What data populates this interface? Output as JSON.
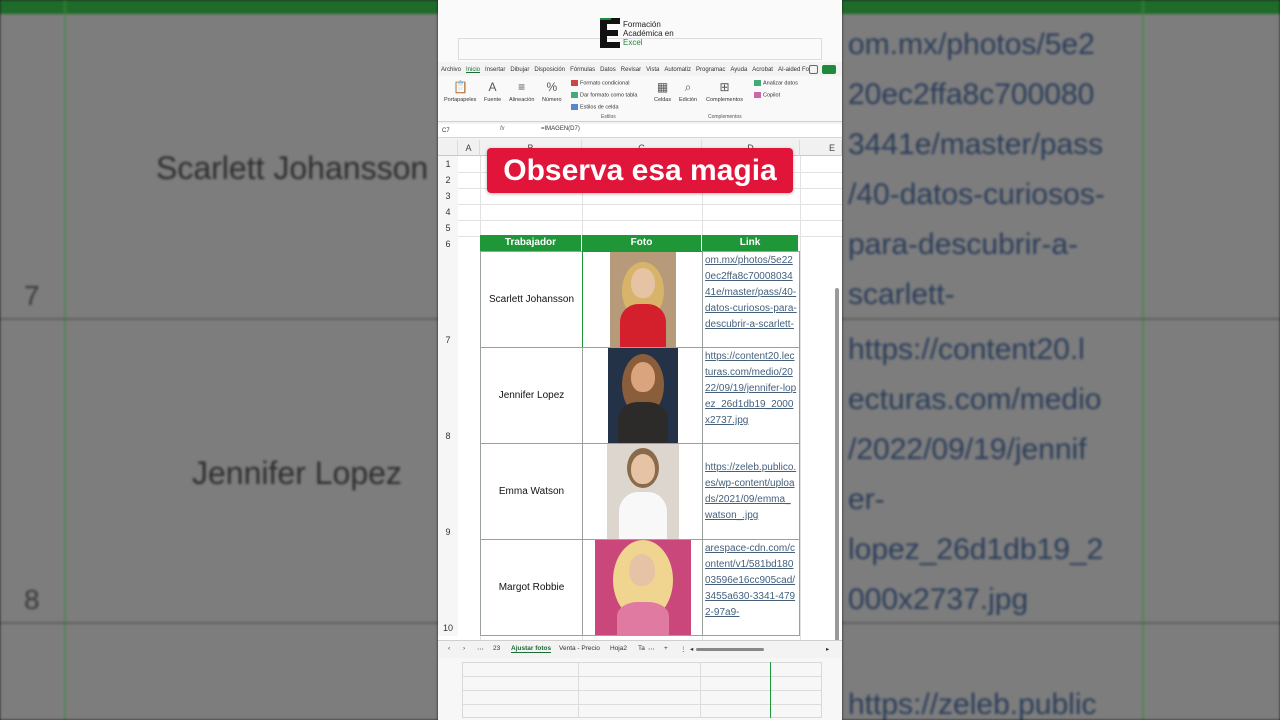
{
  "brand": {
    "line1": "Formación",
    "line2": "Académica en",
    "line3": "Excel"
  },
  "ribbon_tabs": [
    "Archivo",
    "Inicio",
    "Insertar",
    "Dibujar",
    "Disposición",
    "Fórmulas",
    "Datos",
    "Revisar",
    "Vista",
    "Automatiz",
    "Programac",
    "Ayuda",
    "Acrobat",
    "AI-aided Fo"
  ],
  "active_tab": "Inicio",
  "ribbon": {
    "portapapeles": "Portapapeles",
    "fuente": "Fuente",
    "alineacion": "Alineación",
    "numero": "Número",
    "formato_condicional": "Formato condicional",
    "dar_formato": "Dar formato como tabla",
    "estilos_celda": "Estilos de celda",
    "estilos_label": "Estilos",
    "celdas": "Celdas",
    "edicion": "Edición",
    "complementos": "Complementos",
    "complementos_label": "Complementos",
    "analizar": "Analizar datos",
    "copilot": "Copilot"
  },
  "formula_bar": {
    "namebox": "C7",
    "fx": "fx",
    "formula": "=IMAGEN(D7)"
  },
  "columns": [
    "A",
    "B",
    "C",
    "D",
    "E"
  ],
  "rows": [
    "1",
    "2",
    "3",
    "4",
    "5",
    "6",
    "7",
    "8",
    "9",
    "10"
  ],
  "overlay_title": "Observa esa magia",
  "table": {
    "headers": [
      "Trabajador",
      "Foto",
      "Link"
    ],
    "rows": [
      {
        "name": "Scarlett Johansson",
        "link": "om.mx/photos/5e220ec2ffa8c7000803441e/master/pass/40-datos-curiosos-para-descubrir-a-scarlett-"
      },
      {
        "name": "Jennifer Lopez",
        "link": "https://content20.lecturas.com/medio/2022/09/19/jennifer-lopez_26d1db19_2000x2737.jpg"
      },
      {
        "name": "Emma Watson",
        "link": "https://zeleb.publico.es/wp-content/uploads/2021/09/emma_watson_.jpg"
      },
      {
        "name": "Margot Robbie",
        "link": "arespace-cdn.com/content/v1/581bd18003596e16cc905cad/3455a630-3341-4792-97a9-"
      }
    ]
  },
  "sheet_tabs": {
    "count": "23",
    "active": "Ajustar fotos",
    "t2": "Venta - Precio",
    "t3": "Hoja2",
    "t4": "Ta",
    "add": "+",
    "more": "⋮"
  },
  "background": {
    "left_names": [
      "Scarlett Johansson",
      "Jennifer Lopez"
    ],
    "left_rows": [
      "7",
      "8"
    ],
    "right_links": [
      "om.mx/photos/5e2",
      "20ec2ffa8c700080",
      "3441e/master/pass",
      "/40-datos-curiosos-",
      "para-descubrir-a-",
      "scarlett-",
      "https://content20.l",
      "ecturas.com/medio",
      "/2022/09/19/jennif",
      "er-",
      "lopez_26d1db19_2",
      "000x2737.jpg",
      "https://zeleb.public"
    ]
  },
  "colors": {
    "accent_green": "#1f9738",
    "title_red": "#e1143a",
    "link": "#44607d"
  }
}
